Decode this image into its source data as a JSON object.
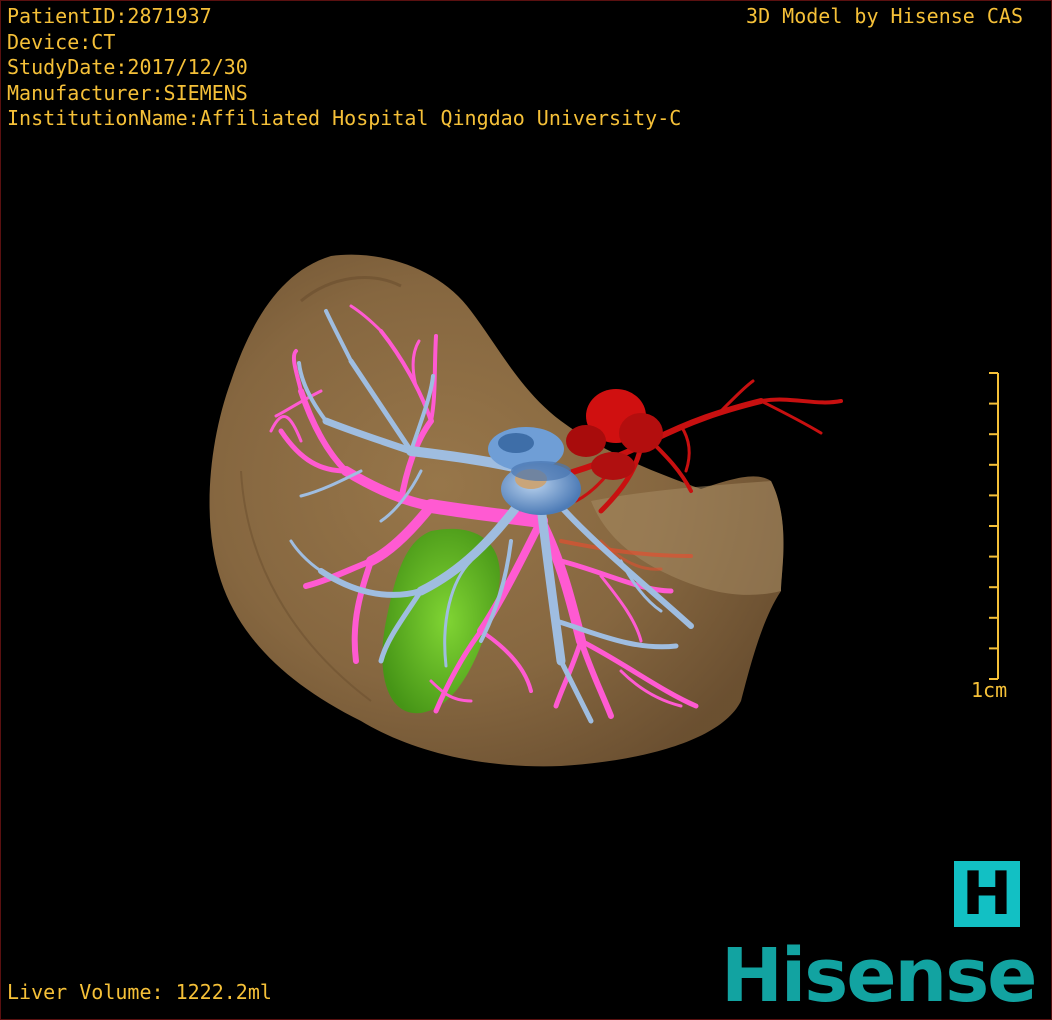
{
  "patient_info": {
    "patient_id": "PatientID:2871937",
    "device": "Device:CT",
    "study_date": "StudyDate:2017/12/30",
    "manufacturer": "Manufacturer:SIEMENS",
    "institution": "InstitutionName:Affiliated Hospital Qingdao University-C"
  },
  "credit": "3D Model by Hisense CAS",
  "scale": {
    "label": "1cm",
    "ticks": 10
  },
  "liver_volume": "Liver Volume: 1222.2ml",
  "brand": {
    "logo_letter": "H",
    "name": "Hisense",
    "color": "#12a3a1"
  },
  "colors": {
    "text": "#f5c038",
    "liver": "#8a6a42",
    "portal_vein": "#ff5ad2",
    "hepatic_vein": "#9fbde0",
    "artery": "#c81010",
    "gallbladder": "#5ec81e"
  }
}
